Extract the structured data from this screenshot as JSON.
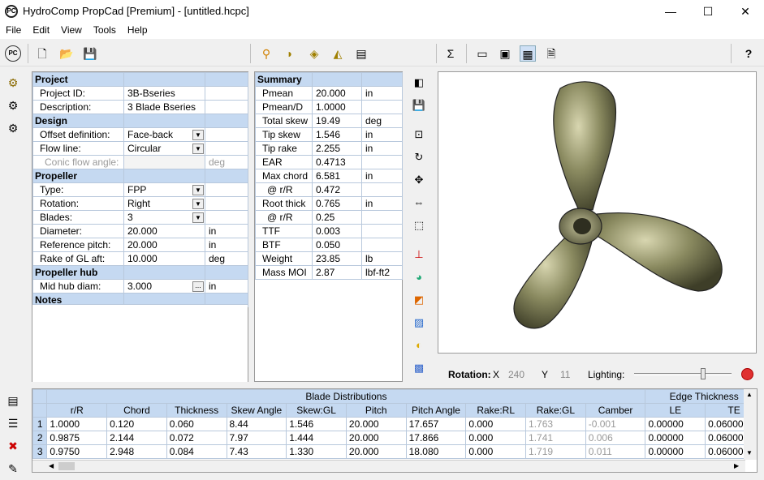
{
  "window": {
    "title": "HydroComp PropCad [Premium] - [untitled.hcpc]",
    "app_icon": "PC",
    "minimize": "—",
    "maximize": "☐",
    "close": "✕"
  },
  "menu": [
    "File",
    "Edit",
    "View",
    "Tools",
    "Help"
  ],
  "project_panel": {
    "sections": {
      "project": "Project",
      "design": "Design",
      "propeller": "Propeller",
      "hub": "Propeller hub",
      "notes": "Notes"
    },
    "rows": {
      "project_id": {
        "label": "Project ID:",
        "value": "3B-Bseries"
      },
      "description": {
        "label": "Description:",
        "value": "3 Blade Bseries"
      },
      "offset_definition": {
        "label": "Offset definition:",
        "value": "Face-back"
      },
      "flow_line": {
        "label": "Flow line:",
        "value": "Circular"
      },
      "conic_flow_angle": {
        "label": "Conic flow angle:",
        "value": "",
        "unit": "deg"
      },
      "type": {
        "label": "Type:",
        "value": "FPP"
      },
      "rotation": {
        "label": "Rotation:",
        "value": "Right"
      },
      "blades": {
        "label": "Blades:",
        "value": "3"
      },
      "diameter": {
        "label": "Diameter:",
        "value": "20.000",
        "unit": "in"
      },
      "reference_pitch": {
        "label": "Reference pitch:",
        "value": "20.000",
        "unit": "in"
      },
      "rake_gl_aft": {
        "label": "Rake of GL aft:",
        "value": "10.000",
        "unit": "deg"
      },
      "mid_hub_diam": {
        "label": "Mid hub diam:",
        "value": "3.000",
        "unit": "in",
        "button": "..."
      }
    }
  },
  "summary": {
    "header": "Summary",
    "rows": [
      {
        "label": "Pmean",
        "value": "20.000",
        "unit": "in"
      },
      {
        "label": "Pmean/D",
        "value": "1.0000",
        "unit": ""
      },
      {
        "label": "Total skew",
        "value": "19.49",
        "unit": "deg"
      },
      {
        "label": "Tip skew",
        "value": "1.546",
        "unit": "in"
      },
      {
        "label": "Tip rake",
        "value": "2.255",
        "unit": "in"
      },
      {
        "label": "EAR",
        "value": "0.4713",
        "unit": ""
      },
      {
        "label": "Max chord",
        "value": "6.581",
        "unit": "in"
      },
      {
        "label": "@ r/R",
        "value": "0.472",
        "unit": ""
      },
      {
        "label": "Root thick",
        "value": "0.765",
        "unit": "in"
      },
      {
        "label": "@ r/R",
        "value": "0.25",
        "unit": ""
      },
      {
        "label": "TTF",
        "value": "0.003",
        "unit": ""
      },
      {
        "label": "BTF",
        "value": "0.050",
        "unit": ""
      },
      {
        "label": "Weight",
        "value": "23.85",
        "unit": "lb"
      },
      {
        "label": "Mass MOI",
        "value": "2.87",
        "unit": "lbf-ft2"
      }
    ]
  },
  "rotation_bar": {
    "label": "Rotation:",
    "x_label": "X",
    "x_value": "240",
    "y_label": "Y",
    "y_value": "11",
    "lighting_label": "Lighting:",
    "lighting_level": 0.72
  },
  "blade_table": {
    "group_header": "Blade Distributions",
    "edge_header": "Edge Thickness",
    "columns": [
      "r/R",
      "Chord",
      "Thickness",
      "Skew Angle",
      "Skew:GL",
      "Pitch",
      "Pitch Angle",
      "Rake:RL",
      "Rake:GL",
      "Camber",
      "LE",
      "TE"
    ],
    "rows": [
      {
        "n": "1",
        "cells": [
          "1.0000",
          "0.120",
          "0.060",
          "8.44",
          "1.546",
          "20.000",
          "17.657",
          "0.000",
          "1.763",
          "-0.001",
          "0.00000",
          "0.06000"
        ]
      },
      {
        "n": "2",
        "cells": [
          "0.9875",
          "2.144",
          "0.072",
          "7.97",
          "1.444",
          "20.000",
          "17.866",
          "0.000",
          "1.741",
          "0.006",
          "0.00000",
          "0.06000"
        ]
      },
      {
        "n": "3",
        "cells": [
          "0.9750",
          "2.948",
          "0.084",
          "7.43",
          "1.330",
          "20.000",
          "18.080",
          "0.000",
          "1.719",
          "0.011",
          "0.00000",
          "0.06000"
        ]
      }
    ]
  },
  "colors": {
    "section_header": "#c5d9f1",
    "grid_border": "#b8c8dc",
    "propeller": "#8a8a60"
  }
}
